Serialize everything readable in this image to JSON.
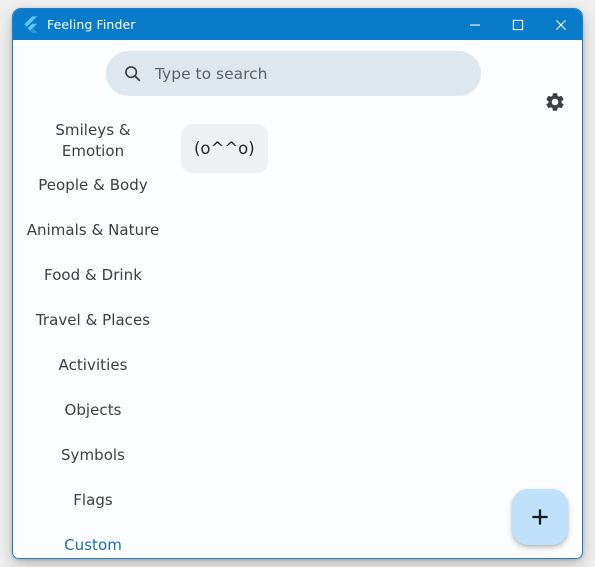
{
  "window": {
    "title": "Feeling Finder",
    "app_icon": "flutter-logo-icon",
    "controls": {
      "minimize_label": "Minimize",
      "maximize_label": "Maximize",
      "close_label": "Close"
    }
  },
  "colors": {
    "titlebar": "#0A7BC8",
    "titlebar_text": "#FFFFFF",
    "window_border": "#2380C4",
    "content_bg": "#FCFDFE",
    "search_bg": "#DEE7EE",
    "search_placeholder_text": "#5C6268",
    "category_text": "#3C4043",
    "category_selected_text": "#1A6FA8",
    "chip_bg": "#EEF1F3",
    "chip_text": "#26292C",
    "fab_bg": "#BFE1FB",
    "fab_icon": "#1A1C1E"
  },
  "search": {
    "icon": "search-icon",
    "value": "",
    "placeholder": "Type to search"
  },
  "settings": {
    "icon": "gear-icon",
    "label": "Settings"
  },
  "categories": {
    "selected": "Custom",
    "items": [
      {
        "label": "Smileys & Emotion",
        "selected": false
      },
      {
        "label": "People & Body",
        "selected": false
      },
      {
        "label": "Animals & Nature",
        "selected": false
      },
      {
        "label": "Food & Drink",
        "selected": false
      },
      {
        "label": "Travel & Places",
        "selected": false
      },
      {
        "label": "Activities",
        "selected": false
      },
      {
        "label": "Objects",
        "selected": false
      },
      {
        "label": "Symbols",
        "selected": false
      },
      {
        "label": "Flags",
        "selected": false
      },
      {
        "label": "Custom",
        "selected": true
      }
    ]
  },
  "emoji_grid": {
    "items": [
      {
        "glyph": "(o^^o)"
      }
    ]
  },
  "fab": {
    "icon": "plus-icon",
    "label": "+"
  }
}
